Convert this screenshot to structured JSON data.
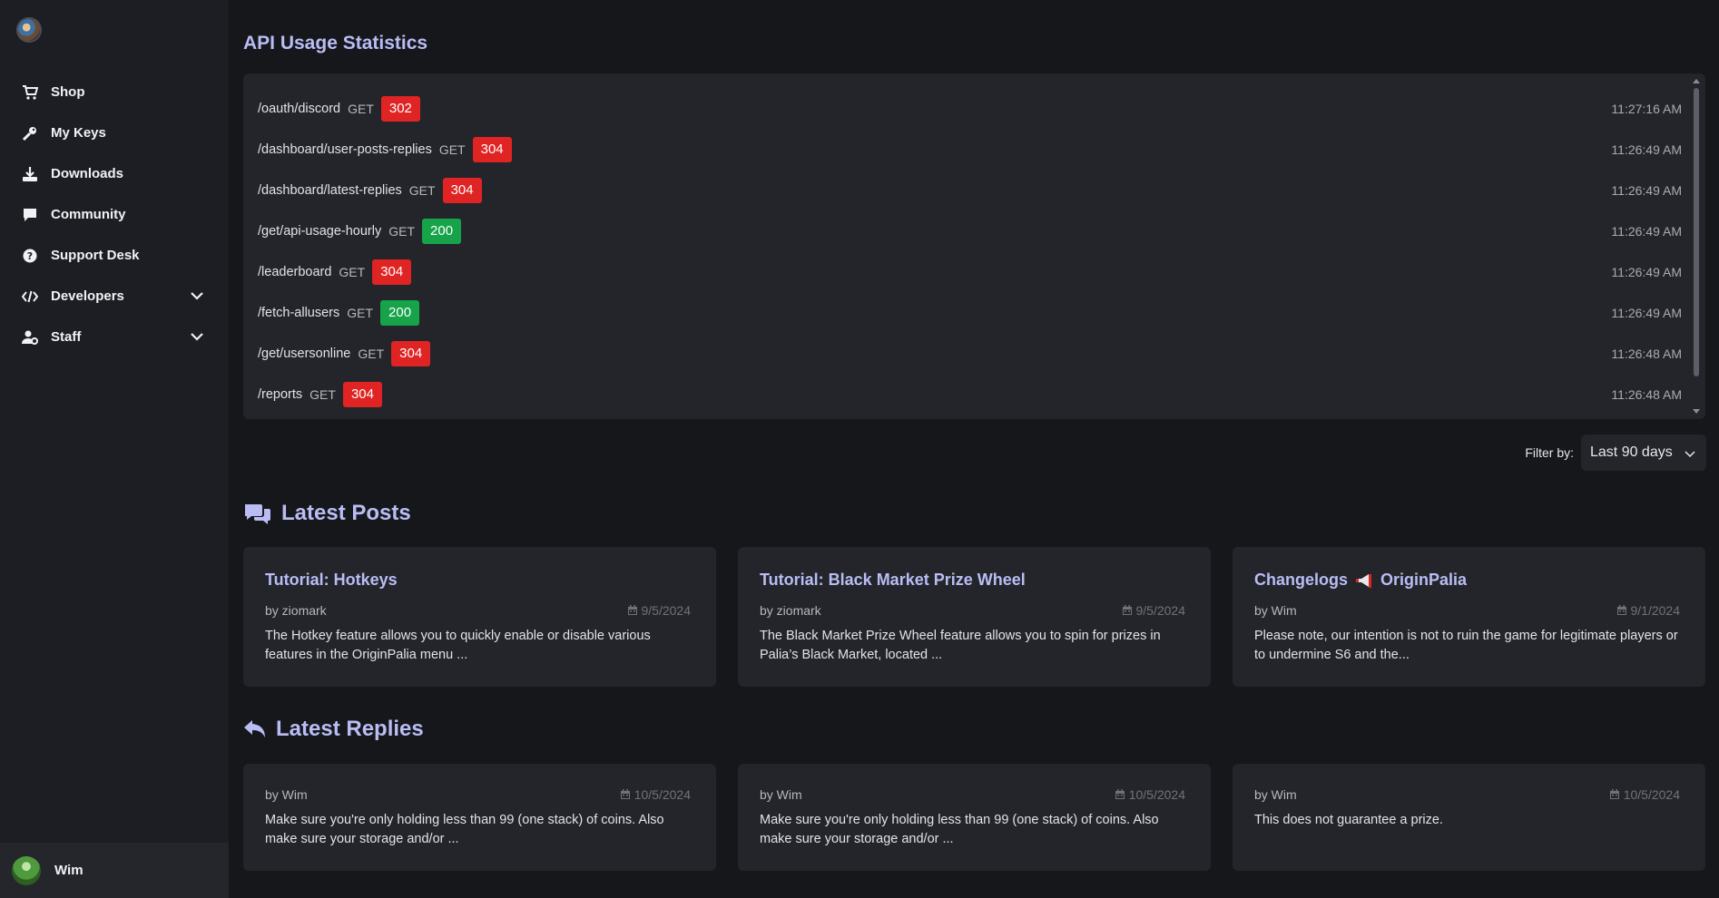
{
  "sidebar": {
    "items": [
      {
        "label": "Shop",
        "icon": "cart-icon"
      },
      {
        "label": "My Keys",
        "icon": "key-icon"
      },
      {
        "label": "Downloads",
        "icon": "download-icon"
      },
      {
        "label": "Community",
        "icon": "comment-icon"
      },
      {
        "label": "Support Desk",
        "icon": "question-circle-icon"
      },
      {
        "label": "Developers",
        "icon": "code-icon"
      },
      {
        "label": "Staff",
        "icon": "user-cog-icon"
      }
    ],
    "user": {
      "name": "Wim"
    }
  },
  "api": {
    "title": "API Usage Statistics",
    "rows": [
      {
        "path": "/oauth/discord",
        "method": "GET",
        "status": "302",
        "color": "#e02424",
        "time": "11:27:16 AM"
      },
      {
        "path": "/dashboard/user-posts-replies",
        "method": "GET",
        "status": "304",
        "color": "#e02424",
        "time": "11:26:49 AM"
      },
      {
        "path": "/dashboard/latest-replies",
        "method": "GET",
        "status": "304",
        "color": "#e02424",
        "time": "11:26:49 AM"
      },
      {
        "path": "/get/api-usage-hourly",
        "method": "GET",
        "status": "200",
        "color": "#17a34a",
        "time": "11:26:49 AM"
      },
      {
        "path": "/leaderboard",
        "method": "GET",
        "status": "304",
        "color": "#e02424",
        "time": "11:26:49 AM"
      },
      {
        "path": "/fetch-allusers",
        "method": "GET",
        "status": "200",
        "color": "#17a34a",
        "time": "11:26:49 AM"
      },
      {
        "path": "/get/usersonline",
        "method": "GET",
        "status": "304",
        "color": "#e02424",
        "time": "11:26:48 AM"
      },
      {
        "path": "/reports",
        "method": "GET",
        "status": "304",
        "color": "#e02424",
        "time": "11:26:48 AM"
      }
    ]
  },
  "filter": {
    "label": "Filter by:",
    "value": "Last 90 days"
  },
  "posts": {
    "title": "Latest Posts",
    "items": [
      {
        "title": "Tutorial: Hotkeys",
        "author": "by ziomark",
        "date": "9/5/2024",
        "body": "The Hotkey feature allows you to quickly enable or disable various features in the OriginPalia menu ..."
      },
      {
        "title": "Tutorial: Black Market Prize Wheel",
        "author": "by ziomark",
        "date": "9/5/2024",
        "body": "The Black Market Prize Wheel feature allows you to spin for prizes in Palia’s Black Market, located ..."
      },
      {
        "title_pre": "Changelogs",
        "title_post": "OriginPalia",
        "author": "by Wim",
        "date": "9/1/2024",
        "body": "Please note, our intention is not to ruin the game for legitimate players or to undermine S6 and the..."
      }
    ]
  },
  "replies": {
    "title": "Latest Replies",
    "items": [
      {
        "author": "by Wim",
        "date": "10/5/2024",
        "body": "Make sure you're only holding less than 99 (one stack) of coins. Also make sure your storage and/or ..."
      },
      {
        "author": "by Wim",
        "date": "10/5/2024",
        "body": "Make sure you're only holding less than 99 (one stack) of coins. Also make sure your storage and/or ..."
      },
      {
        "author": "by Wim",
        "date": "10/5/2024",
        "body": "This does not guarantee a prize."
      }
    ]
  },
  "colors": {
    "accent": "#b9bdf4",
    "error": "#e02424",
    "success": "#17a34a"
  }
}
